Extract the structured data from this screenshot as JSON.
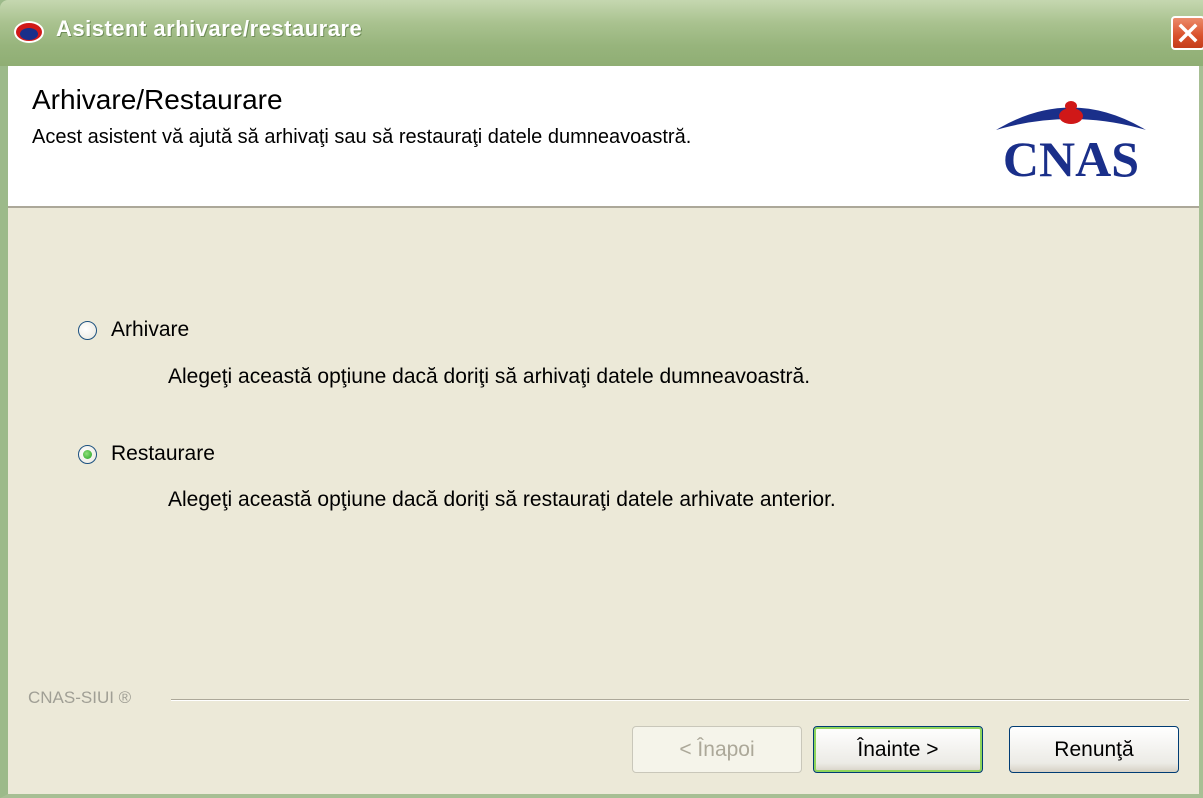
{
  "window": {
    "title": "Asistent arhivare/restaurare"
  },
  "header": {
    "title": "Arhivare/Restaurare",
    "subtitle": "Acest asistent vă ajută să arhivaţi sau să restauraţi datele dumneavoastră.",
    "logo_text": "CNAS"
  },
  "options": [
    {
      "label": "Arhivare",
      "description": "Alegeţi această opţiune dacă doriţi să arhivaţi datele dumneavoastră.",
      "checked": false
    },
    {
      "label": "Restaurare",
      "description": "Alegeţi această opţiune dacă doriţi să restauraţi datele arhivate anterior.",
      "checked": true
    }
  ],
  "footer": {
    "label": "CNAS-SIUI ®"
  },
  "buttons": {
    "back": "< Înapoi",
    "next": "Înainte >",
    "cancel": "Renunţă"
  },
  "colors": {
    "titlebar": "#a9c28f",
    "dialog_bg": "#ece9d8",
    "logo_blue": "#1a2f8a",
    "logo_red": "#d01818"
  }
}
